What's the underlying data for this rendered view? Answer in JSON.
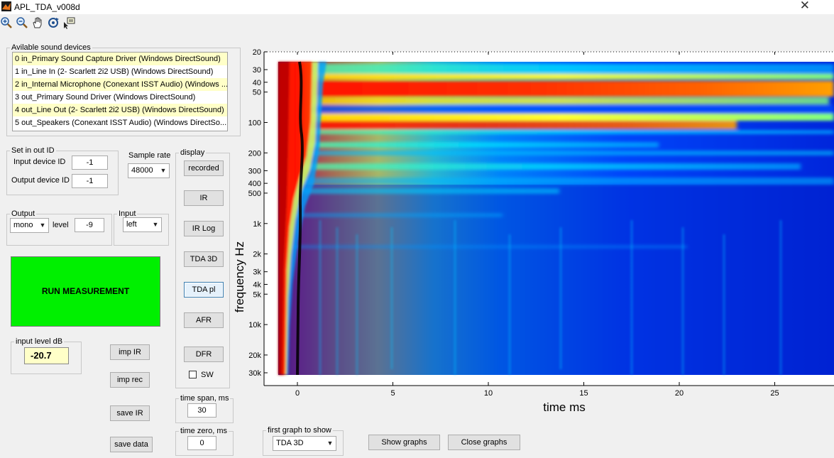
{
  "window": {
    "title": "APL_TDA_v008d",
    "close_glyph": "✕"
  },
  "toolbar": {
    "icons": [
      "zoom-in-icon",
      "zoom-out-icon",
      "pan-hand-icon",
      "rotate-icon",
      "data-cursor-icon"
    ]
  },
  "devices": {
    "legend": "Avilable sound devices",
    "items": [
      "0 in_Primary Sound Capture Driver (Windows DirectSound)",
      "1 in_Line In (2- Scarlett 2i2 USB) (Windows DirectSound)",
      "2 in_Internal Microphone (Conexant ISST Audio) (Windows ...",
      "3 out_Primary Sound Driver (Windows DirectSound)",
      "4 out_Line Out (2- Scarlett 2i2 USB) (Windows DirectSound)",
      "5 out_Speakers (Conexant ISST Audio) (Windows DirectSo..."
    ]
  },
  "io": {
    "legend": "Set in out ID",
    "input_label": "Input device ID",
    "input_value": "-1",
    "output_label": "Output device ID",
    "output_value": "-1"
  },
  "sample_rate": {
    "label": "Sample rate",
    "value": "48000"
  },
  "output": {
    "legend": "Output",
    "mode": "mono",
    "level_label": "level",
    "level_value": "-9"
  },
  "input": {
    "legend": "Input",
    "channel": "left"
  },
  "run_label": "RUN MEASUREMENT",
  "input_level": {
    "legend": "input level dB",
    "value": "-20.7"
  },
  "display": {
    "legend": "display",
    "buttons": [
      "recorded",
      "IR",
      "IR Log",
      "TDA 3D",
      "TDA pl",
      "AFR",
      "DFR"
    ],
    "sw_label": "SW"
  },
  "file_buttons": {
    "imp_ir": "imp IR",
    "imp_rec": "imp rec",
    "save_ir": "save IR",
    "save_data": "save data"
  },
  "time_span": {
    "legend": "time span, ms",
    "value": "30"
  },
  "time_zero": {
    "legend": "time zero, ms",
    "value": "0"
  },
  "first_graph": {
    "legend": "first graph to show",
    "value": "TDA 3D"
  },
  "show_graphs": "Show graphs",
  "close_graphs": "Close graphs",
  "plot": {
    "xlabel": "time   ms",
    "ylabel": "frequency   Hz",
    "x_ticks": [
      "0",
      "5",
      "10",
      "15",
      "20",
      "25"
    ],
    "y_ticks": [
      "20",
      "30",
      "40",
      "50",
      "100",
      "200",
      "300",
      "400",
      "500",
      "1k",
      "2k",
      "3k",
      "4k",
      "5k",
      "10k",
      "20k",
      "30k"
    ],
    "colormap": "jet"
  }
}
